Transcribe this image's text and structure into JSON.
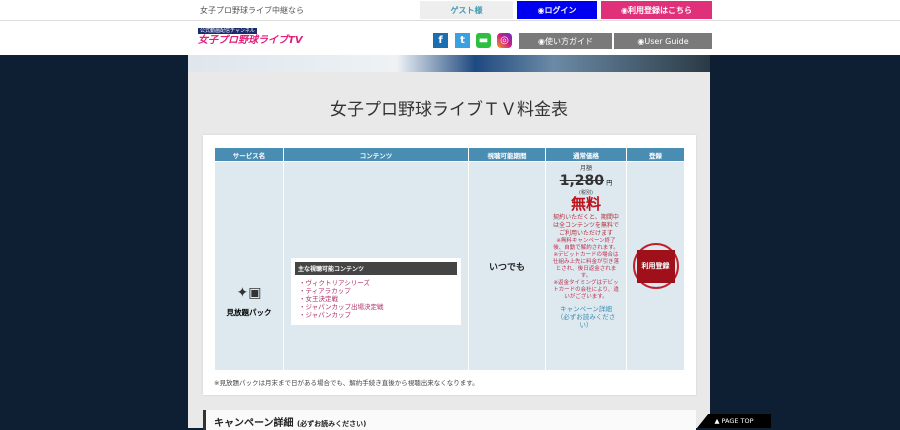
{
  "topbar": {
    "tagline": "女子プロ野球ライブ中継なら",
    "guest": "ゲスト様",
    "login": "ログイン",
    "register": "利用登録はこちら"
  },
  "header": {
    "logo_text": "女子プロ野球ライブTV",
    "logo_sub": "公式動画配信チャンネル",
    "guide_jp": "使い方ガイド",
    "guide_en": "User Guide"
  },
  "page": {
    "title": "女子プロ野球ライブＴＶ料金表"
  },
  "table": {
    "headers": [
      "サービス名",
      "コンテンツ",
      "視聴可能期間",
      "通常価格",
      "登録"
    ],
    "service_name": "見放題パック",
    "contents_heading": "主な視聴可能コンテンツ",
    "contents": [
      "・ヴィクトリアシリーズ",
      "・ティアラカップ",
      "・女王決定戦",
      "・ジャパンカップ出場決定戦",
      "・ジャパンカップ"
    ],
    "period": "いつでも",
    "price_label": "月額",
    "price": "1,280",
    "price_unit": "円",
    "tax": "(税別)",
    "free": "無料",
    "free_desc": "契約いただくと、期間中は全コンテンツを無料でご利用いただけます",
    "note1": "※無料キャンペーン終了後、自動で解約されます。",
    "note2": "※デビットカードの場合は仕組み上先に料金が引き落とされ、後日返金されます。",
    "note3": "※返金タイミングはデビットカードの会社により、違いがございます。",
    "campaign_link": "キャンペーン詳細（必ずお読みください）",
    "register": "利用登録"
  },
  "footnote": "※見放題パックは月末まで日がある場合でも、解約手続き直後から視聴出来なくなります。",
  "campaign": {
    "title": "キャンペーン詳細",
    "sub": "(必ずお読みください)"
  },
  "pagetop": "▲ PAGE TOP"
}
